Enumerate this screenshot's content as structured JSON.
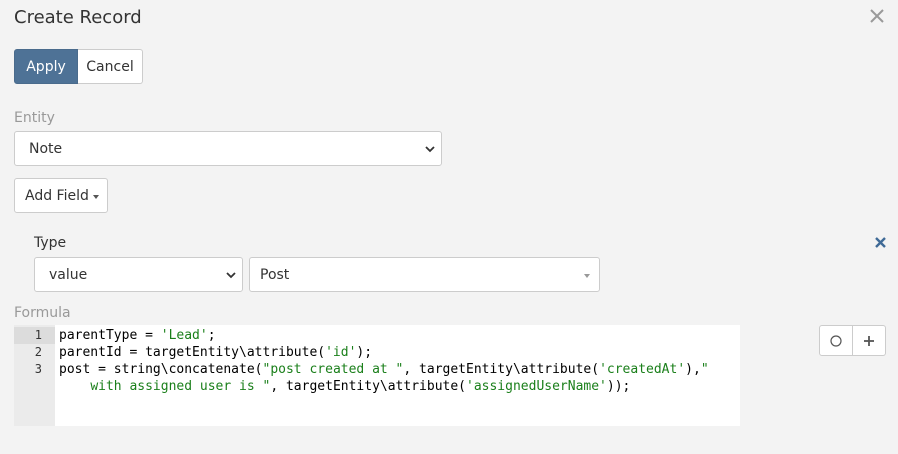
{
  "dialog": {
    "title": "Create Record"
  },
  "actions": {
    "apply_label": "Apply",
    "cancel_label": "Cancel"
  },
  "entity": {
    "label": "Entity",
    "selected": "Note"
  },
  "add_field": {
    "label": "Add Field"
  },
  "type_row": {
    "label": "Type",
    "value_type": "value",
    "field_value": "Post"
  },
  "formula": {
    "label": "Formula",
    "line_numbers": [
      "1",
      "2",
      "3"
    ],
    "lines": [
      {
        "parts": [
          {
            "t": "parentType = "
          },
          {
            "t": "'Lead'",
            "s": true
          },
          {
            "t": ";"
          }
        ]
      },
      {
        "parts": [
          {
            "t": "parentId = targetEntity\\attribute("
          },
          {
            "t": "'id'",
            "s": true
          },
          {
            "t": ");"
          }
        ]
      },
      {
        "parts": [
          {
            "t": "post = string\\concatenate("
          },
          {
            "t": "\"post created at \"",
            "s": true
          },
          {
            "t": ", targetEntity\\attribute("
          },
          {
            "t": "'createdAt'",
            "s": true
          },
          {
            "t": "),"
          },
          {
            "t": "\"",
            "s": true
          }
        ]
      },
      {
        "parts": [
          {
            "t": "    "
          },
          {
            "t": "with assigned user is \"",
            "s": true
          },
          {
            "t": ", targetEntity\\attribute("
          },
          {
            "t": "'assignedUserName'",
            "s": true
          },
          {
            "t": "));"
          }
        ]
      }
    ]
  },
  "icons": {
    "close": "close-icon",
    "remove": "remove-icon",
    "circle": "circle-icon",
    "plus": "plus-icon"
  },
  "colors": {
    "primary": "#4e7296",
    "remove_x": "#3f6a96",
    "string": "#1a7f1a"
  }
}
